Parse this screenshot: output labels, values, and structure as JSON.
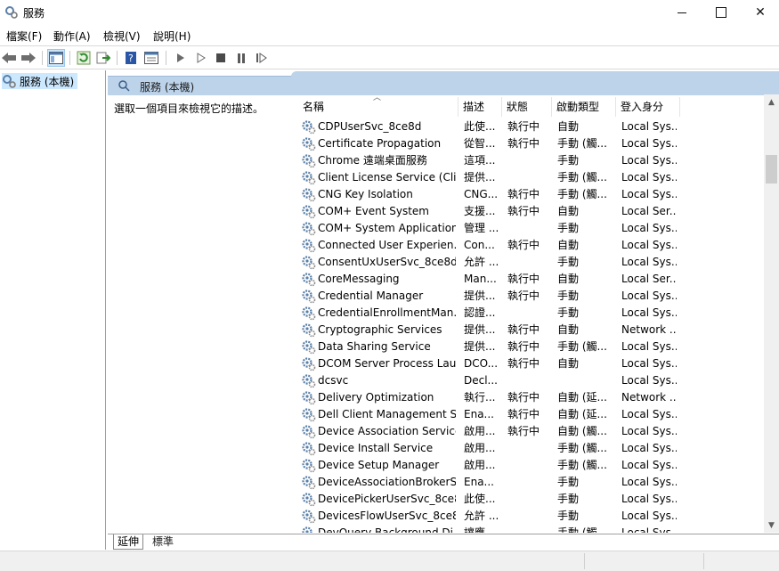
{
  "window": {
    "title": "服務"
  },
  "menu": [
    {
      "label": "檔案(F)"
    },
    {
      "label": "動作(A)"
    },
    {
      "label": "檢視(V)"
    },
    {
      "label": "說明(H)"
    }
  ],
  "toolbar": {
    "icons": [
      "back-arrow-icon",
      "forward-arrow-icon",
      "show-hide-tree-icon",
      "refresh-icon",
      "export-list-icon",
      "help-icon",
      "properties-icon",
      "play-icon",
      "play-outline-icon",
      "stop-icon",
      "pause-icon",
      "resume-icon"
    ]
  },
  "tree": {
    "selected_label": "服務 (本機)"
  },
  "header": {
    "title": "服務 (本機)"
  },
  "description_pane": {
    "text": "選取一個項目來檢視它的描述。"
  },
  "columns": [
    "名稱",
    "描述",
    "狀態",
    "啟動類型",
    "登入身分"
  ],
  "services": [
    {
      "name": "CDPUserSvc_8ce8d",
      "desc": "此使...",
      "status": "執行中",
      "start": "自動",
      "logon": "Local Sys..."
    },
    {
      "name": "Certificate Propagation",
      "desc": "從智...",
      "status": "執行中",
      "start": "手動 (觸...",
      "logon": "Local Sys..."
    },
    {
      "name": "Chrome 遠端桌面服務",
      "desc": "這項...",
      "status": "",
      "start": "手動",
      "logon": "Local Sys..."
    },
    {
      "name": "Client License Service (Cli...",
      "desc": "提供...",
      "status": "",
      "start": "手動 (觸...",
      "logon": "Local Sys..."
    },
    {
      "name": "CNG Key Isolation",
      "desc": "CNG...",
      "status": "執行中",
      "start": "手動 (觸...",
      "logon": "Local Sys..."
    },
    {
      "name": "COM+ Event System",
      "desc": "支援...",
      "status": "執行中",
      "start": "自動",
      "logon": "Local Ser..."
    },
    {
      "name": "COM+ System Application",
      "desc": "管理 ...",
      "status": "",
      "start": "手動",
      "logon": "Local Sys..."
    },
    {
      "name": "Connected User Experien...",
      "desc": "Con...",
      "status": "執行中",
      "start": "自動",
      "logon": "Local Sys..."
    },
    {
      "name": "ConsentUxUserSvc_8ce8d",
      "desc": "允許 ...",
      "status": "",
      "start": "手動",
      "logon": "Local Sys..."
    },
    {
      "name": "CoreMessaging",
      "desc": "Man...",
      "status": "執行中",
      "start": "自動",
      "logon": "Local Ser..."
    },
    {
      "name": "Credential Manager",
      "desc": "提供...",
      "status": "執行中",
      "start": "手動",
      "logon": "Local Sys..."
    },
    {
      "name": "CredentialEnrollmentMan...",
      "desc": "認證...",
      "status": "",
      "start": "手動",
      "logon": "Local Sys..."
    },
    {
      "name": "Cryptographic Services",
      "desc": "提供...",
      "status": "執行中",
      "start": "自動",
      "logon": "Network ..."
    },
    {
      "name": "Data Sharing Service",
      "desc": "提供...",
      "status": "執行中",
      "start": "手動 (觸...",
      "logon": "Local Sys..."
    },
    {
      "name": "DCOM Server Process Lau...",
      "desc": "DCO...",
      "status": "執行中",
      "start": "自動",
      "logon": "Local Sys..."
    },
    {
      "name": "dcsvc",
      "desc": "Decl...",
      "status": "",
      "start": "",
      "logon": "Local Sys..."
    },
    {
      "name": "Delivery Optimization",
      "desc": "執行...",
      "status": "執行中",
      "start": "自動 (延...",
      "logon": "Network ..."
    },
    {
      "name": "Dell Client Management S...",
      "desc": "Ena...",
      "status": "執行中",
      "start": "自動 (延...",
      "logon": "Local Sys..."
    },
    {
      "name": "Device Association Service",
      "desc": "啟用...",
      "status": "執行中",
      "start": "自動 (觸...",
      "logon": "Local Sys..."
    },
    {
      "name": "Device Install Service",
      "desc": "啟用...",
      "status": "",
      "start": "手動 (觸...",
      "logon": "Local Sys..."
    },
    {
      "name": "Device Setup Manager",
      "desc": "啟用...",
      "status": "",
      "start": "手動 (觸...",
      "logon": "Local Sys..."
    },
    {
      "name": "DeviceAssociationBrokerS...",
      "desc": "Ena...",
      "status": "",
      "start": "手動",
      "logon": "Local Sys..."
    },
    {
      "name": "DevicePickerUserSvc_8ce8d",
      "desc": "此使...",
      "status": "",
      "start": "手動",
      "logon": "Local Sys..."
    },
    {
      "name": "DevicesFlowUserSvc_8ce8d",
      "desc": "允許 ...",
      "status": "",
      "start": "手動",
      "logon": "Local Sys..."
    },
    {
      "name": "DevQuery Background Di...",
      "desc": "讓應...",
      "status": "",
      "start": "手動 (觸...",
      "logon": "Local Sys..."
    }
  ],
  "tabs": [
    {
      "label": "延伸"
    },
    {
      "label": "標準"
    }
  ]
}
